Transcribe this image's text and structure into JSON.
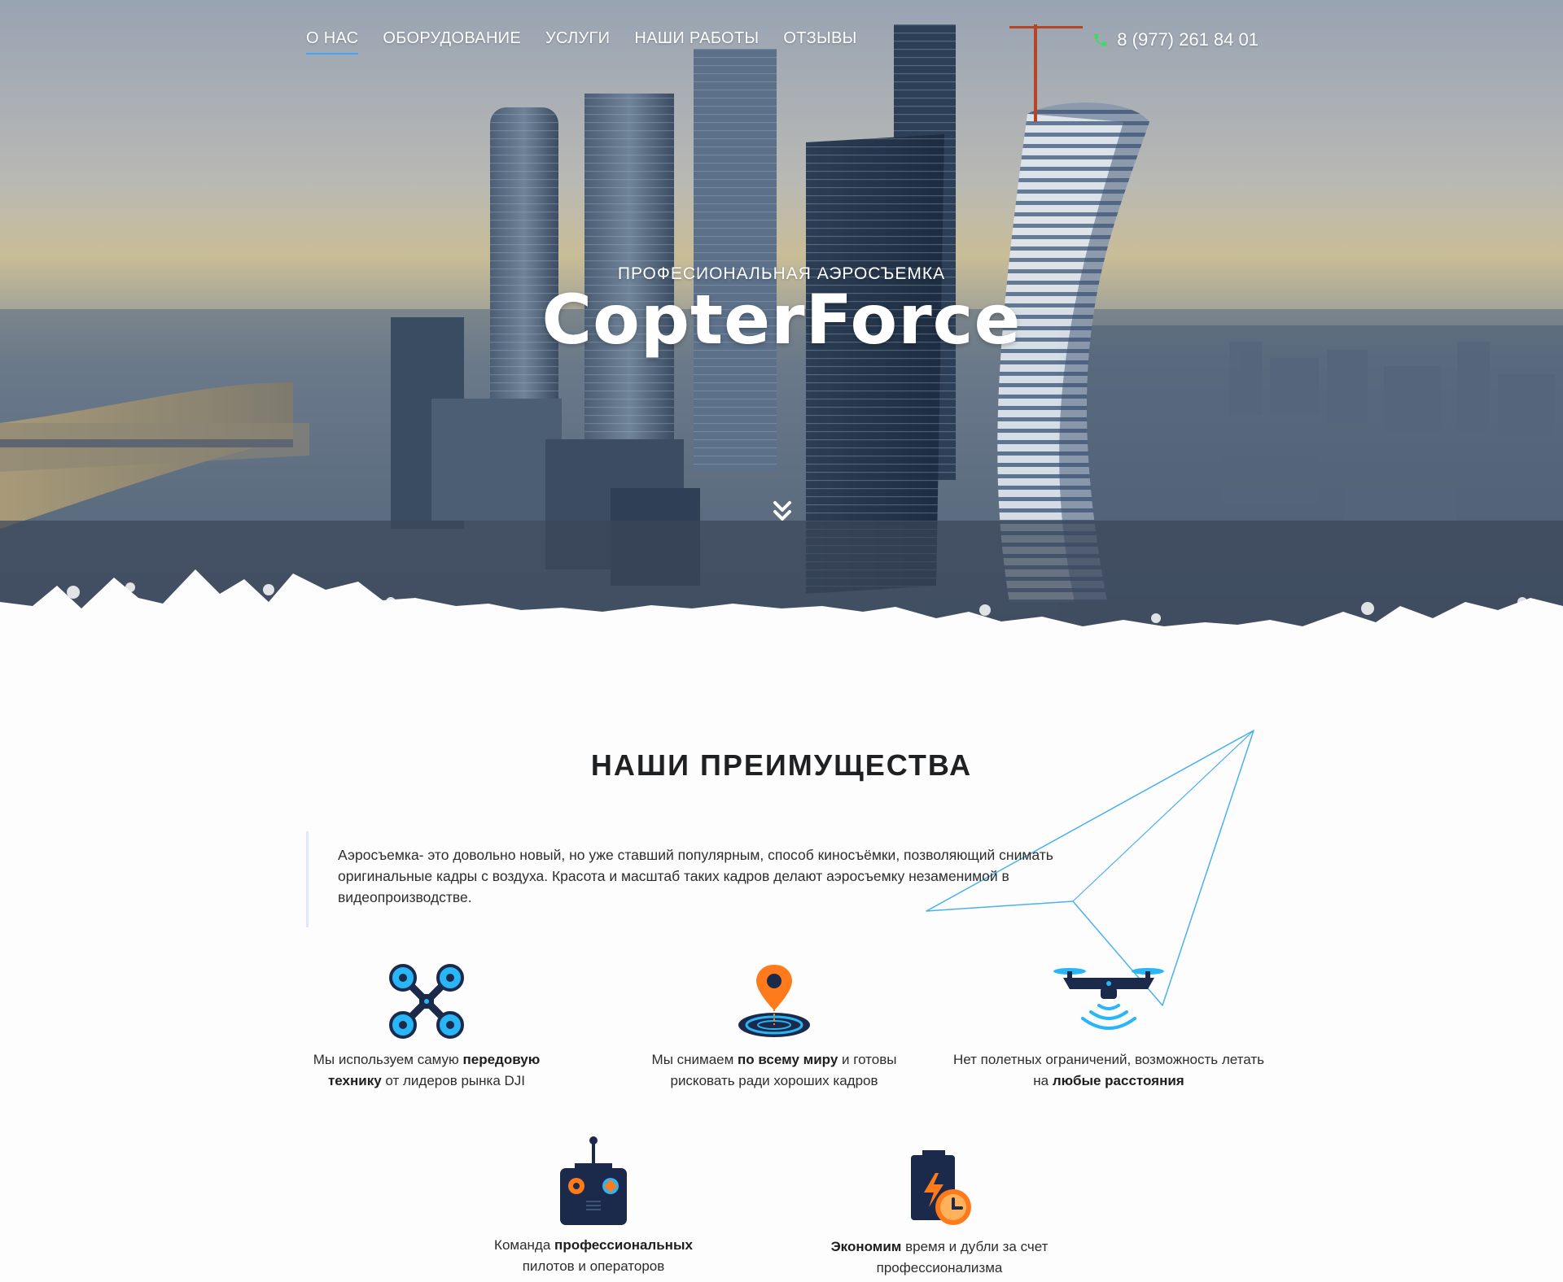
{
  "nav": {
    "items": [
      {
        "label": "О НАС",
        "active": true
      },
      {
        "label": "ОБОРУДОВАНИЕ",
        "active": false
      },
      {
        "label": "УСЛУГИ",
        "active": false
      },
      {
        "label": "НАШИ РАБОТЫ",
        "active": false
      },
      {
        "label": "ОТЗЫВЫ",
        "active": false
      }
    ],
    "phone": "8 (977) 261 84 01"
  },
  "hero": {
    "subtitle": "ПРОФЕСИОНАЛЬНАЯ АЭРОСЪЕМКА",
    "title": "CopterForce"
  },
  "advantages": {
    "title": "НАШИ ПРЕИМУЩЕСТВА",
    "intro": "Аэросъемка- это довольно новый, но уже ставший популярным, способ киносъёмки, позволяющий снимать оригинальные кадры с воздуха. Красота и масштаб таких кадров делают аэросъемку незаменимой в видеопроизводстве.",
    "features": [
      {
        "icon": "quadcopter-icon",
        "text_pre": "Мы используем самую ",
        "text_bold": "передовую технику",
        "text_post": " от лидеров рынка DJI"
      },
      {
        "icon": "location-pin-icon",
        "text_pre": "Мы снимаем ",
        "text_bold": "по всему миру",
        "text_post": " и готовы рисковать ради хороших кадров"
      },
      {
        "icon": "drone-signal-icon",
        "text_pre": "Нет полетных ограничений, возможность летать на ",
        "text_bold": "любые расстояния",
        "text_post": ""
      },
      {
        "icon": "remote-controller-icon",
        "text_pre": "Команда ",
        "text_bold": "профессиональных",
        "text_post": " пилотов и операторов"
      },
      {
        "icon": "battery-clock-icon",
        "text_pre": "",
        "text_bold": "Экономим",
        "text_post": " время и дубли за счет профессионализма"
      }
    ]
  },
  "colors": {
    "accent": "#3ea7ff",
    "phone_icon": "#3ddc5a",
    "icon_navy": "#1b2a4a",
    "icon_cyan": "#29b6f6",
    "icon_orange": "#ff7a1a"
  }
}
